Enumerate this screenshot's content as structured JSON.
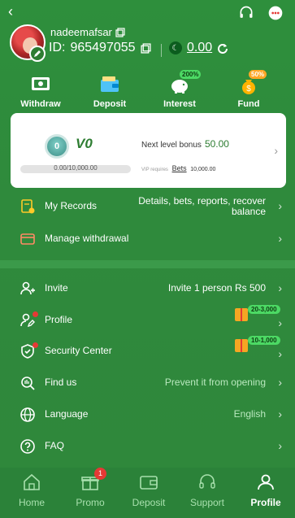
{
  "header": {
    "username": "nadeemafsar",
    "id_label": "ID:",
    "id_value": "965497055",
    "balance": "0.00"
  },
  "actions": [
    {
      "label": "Withdraw",
      "tag": ""
    },
    {
      "label": "Deposit",
      "tag": ""
    },
    {
      "label": "Interest",
      "tag": "200%"
    },
    {
      "label": "Fund",
      "tag": "50%"
    }
  ],
  "vip": {
    "level_badge": "0",
    "level": "V0",
    "progress_text": "0.00/10,000.00",
    "progress_fraction": 0.0,
    "next_label": "Next level bonus",
    "next_value": "50.00",
    "req_label": "VIP requires",
    "req_link": "Bets",
    "req_value": "10,000.00"
  },
  "records": [
    {
      "label": "My Records",
      "value": "Details, bets, reports, recover balance"
    },
    {
      "label": "Manage withdrawal",
      "value": ""
    }
  ],
  "settings": [
    {
      "label": "Invite",
      "value": "Invite 1 person Rs 500"
    },
    {
      "label": "Profile",
      "value": "",
      "gift": "20-3,000"
    },
    {
      "label": "Security Center",
      "value": "",
      "gift": "10-1,000"
    },
    {
      "label": "Find us",
      "value": "Prevent it from opening"
    },
    {
      "label": "Language",
      "value": "English"
    },
    {
      "label": "FAQ",
      "value": ""
    }
  ],
  "nav": [
    {
      "label": "Home"
    },
    {
      "label": "Promo",
      "badge": "1"
    },
    {
      "label": "Deposit"
    },
    {
      "label": "Support"
    },
    {
      "label": "Profile"
    }
  ],
  "colors": {
    "background": "#2f8a3e",
    "accent_green": "#4cd964",
    "badge_red": "#e53935"
  }
}
